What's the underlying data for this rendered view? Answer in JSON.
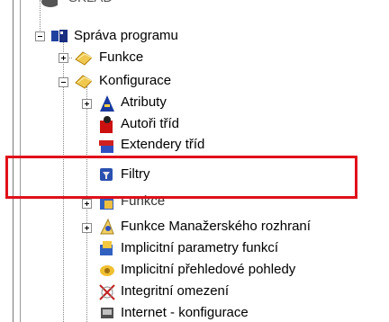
{
  "tree": {
    "partial_top_label": "SKLAD",
    "root": {
      "label": "Správa programu",
      "icon": "app-cube-icon"
    },
    "level1": [
      {
        "label": "Funkce",
        "icon": "folder-icon",
        "expander": "plus"
      },
      {
        "label": "Konfigurace",
        "icon": "folder-icon",
        "expander": "minus"
      }
    ],
    "level2": [
      {
        "label": "Atributy",
        "icon": "attributes-icon",
        "expander": "plus"
      },
      {
        "label": "Autoři tříd",
        "icon": "class-authors-icon"
      },
      {
        "label": "Extendery tříd",
        "icon": "class-extenders-icon"
      },
      {
        "label": "Filtry",
        "icon": "filter-icon"
      },
      {
        "label": "Funkce",
        "icon": "functions-icon",
        "expander": "plus"
      },
      {
        "label": "Funkce Manažerského rozhraní",
        "icon": "manager-functions-icon",
        "expander": "plus"
      },
      {
        "label": "Implicitní parametry funkcí",
        "icon": "default-params-icon"
      },
      {
        "label": "Implicitní přehledové pohledy",
        "icon": "default-views-icon"
      },
      {
        "label": "Integritní omezení",
        "icon": "integrity-icon"
      },
      {
        "label": "Internet - konfigurace",
        "icon": "internet-config-icon"
      }
    ]
  },
  "highlight_color": "#e0101a"
}
